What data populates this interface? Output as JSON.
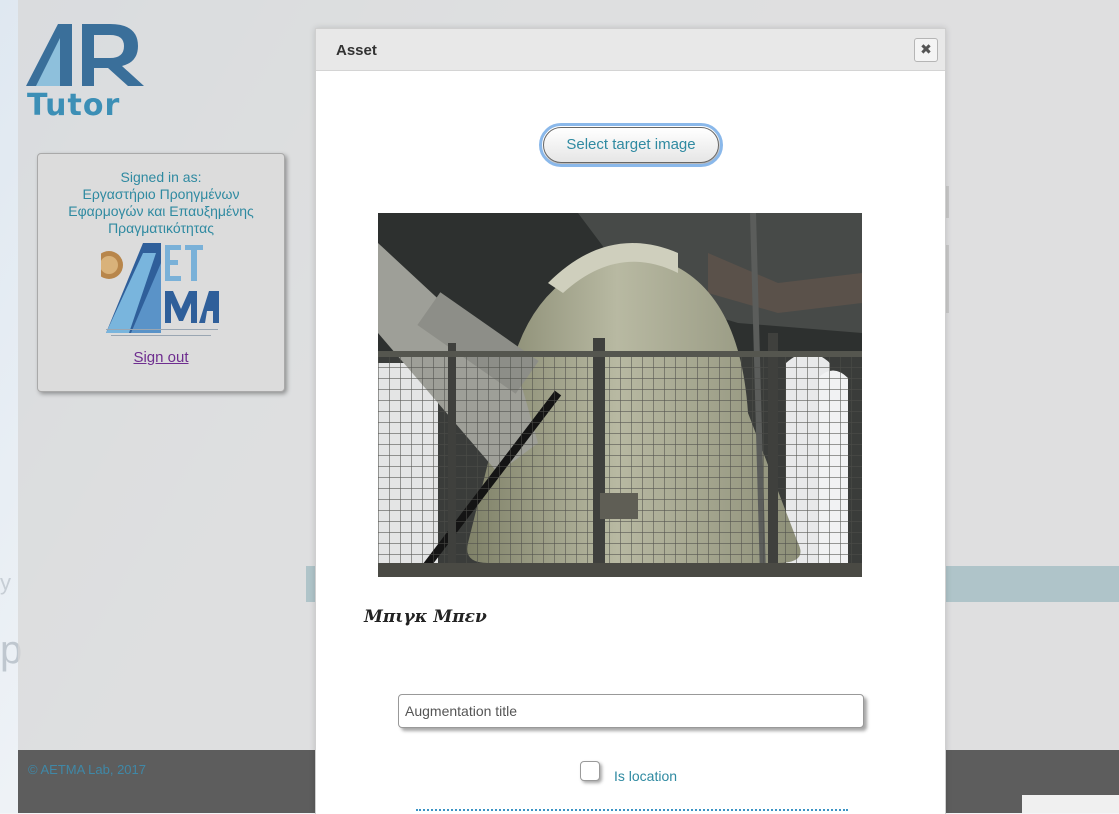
{
  "brand": {
    "logo_letters": "AR",
    "logo_subtitle": "Tutor",
    "accent_color": "#3c8fb6"
  },
  "user_panel": {
    "signed_in_label": "Signed in as:",
    "user_name_line1": "Εργαστήριο Προηγμένων",
    "user_name_line2": "Εφαρμογών και Επαυξημένης",
    "user_name_line3": "Πραγματικότητας",
    "org_logo_icon": "aetma-logo",
    "org_logo_text": "AETMA",
    "sign_out": "Sign out"
  },
  "footer": {
    "copyright": "© AETMA Lab, 2017"
  },
  "modal": {
    "title": "Asset",
    "close_icon": "close-icon",
    "select_target_button": "Select target image",
    "image_caption": "Μπιγκ Μπεν",
    "augmentation_title_placeholder": "Augmentation title",
    "is_location_label": "Is location",
    "is_location_checked": false
  }
}
